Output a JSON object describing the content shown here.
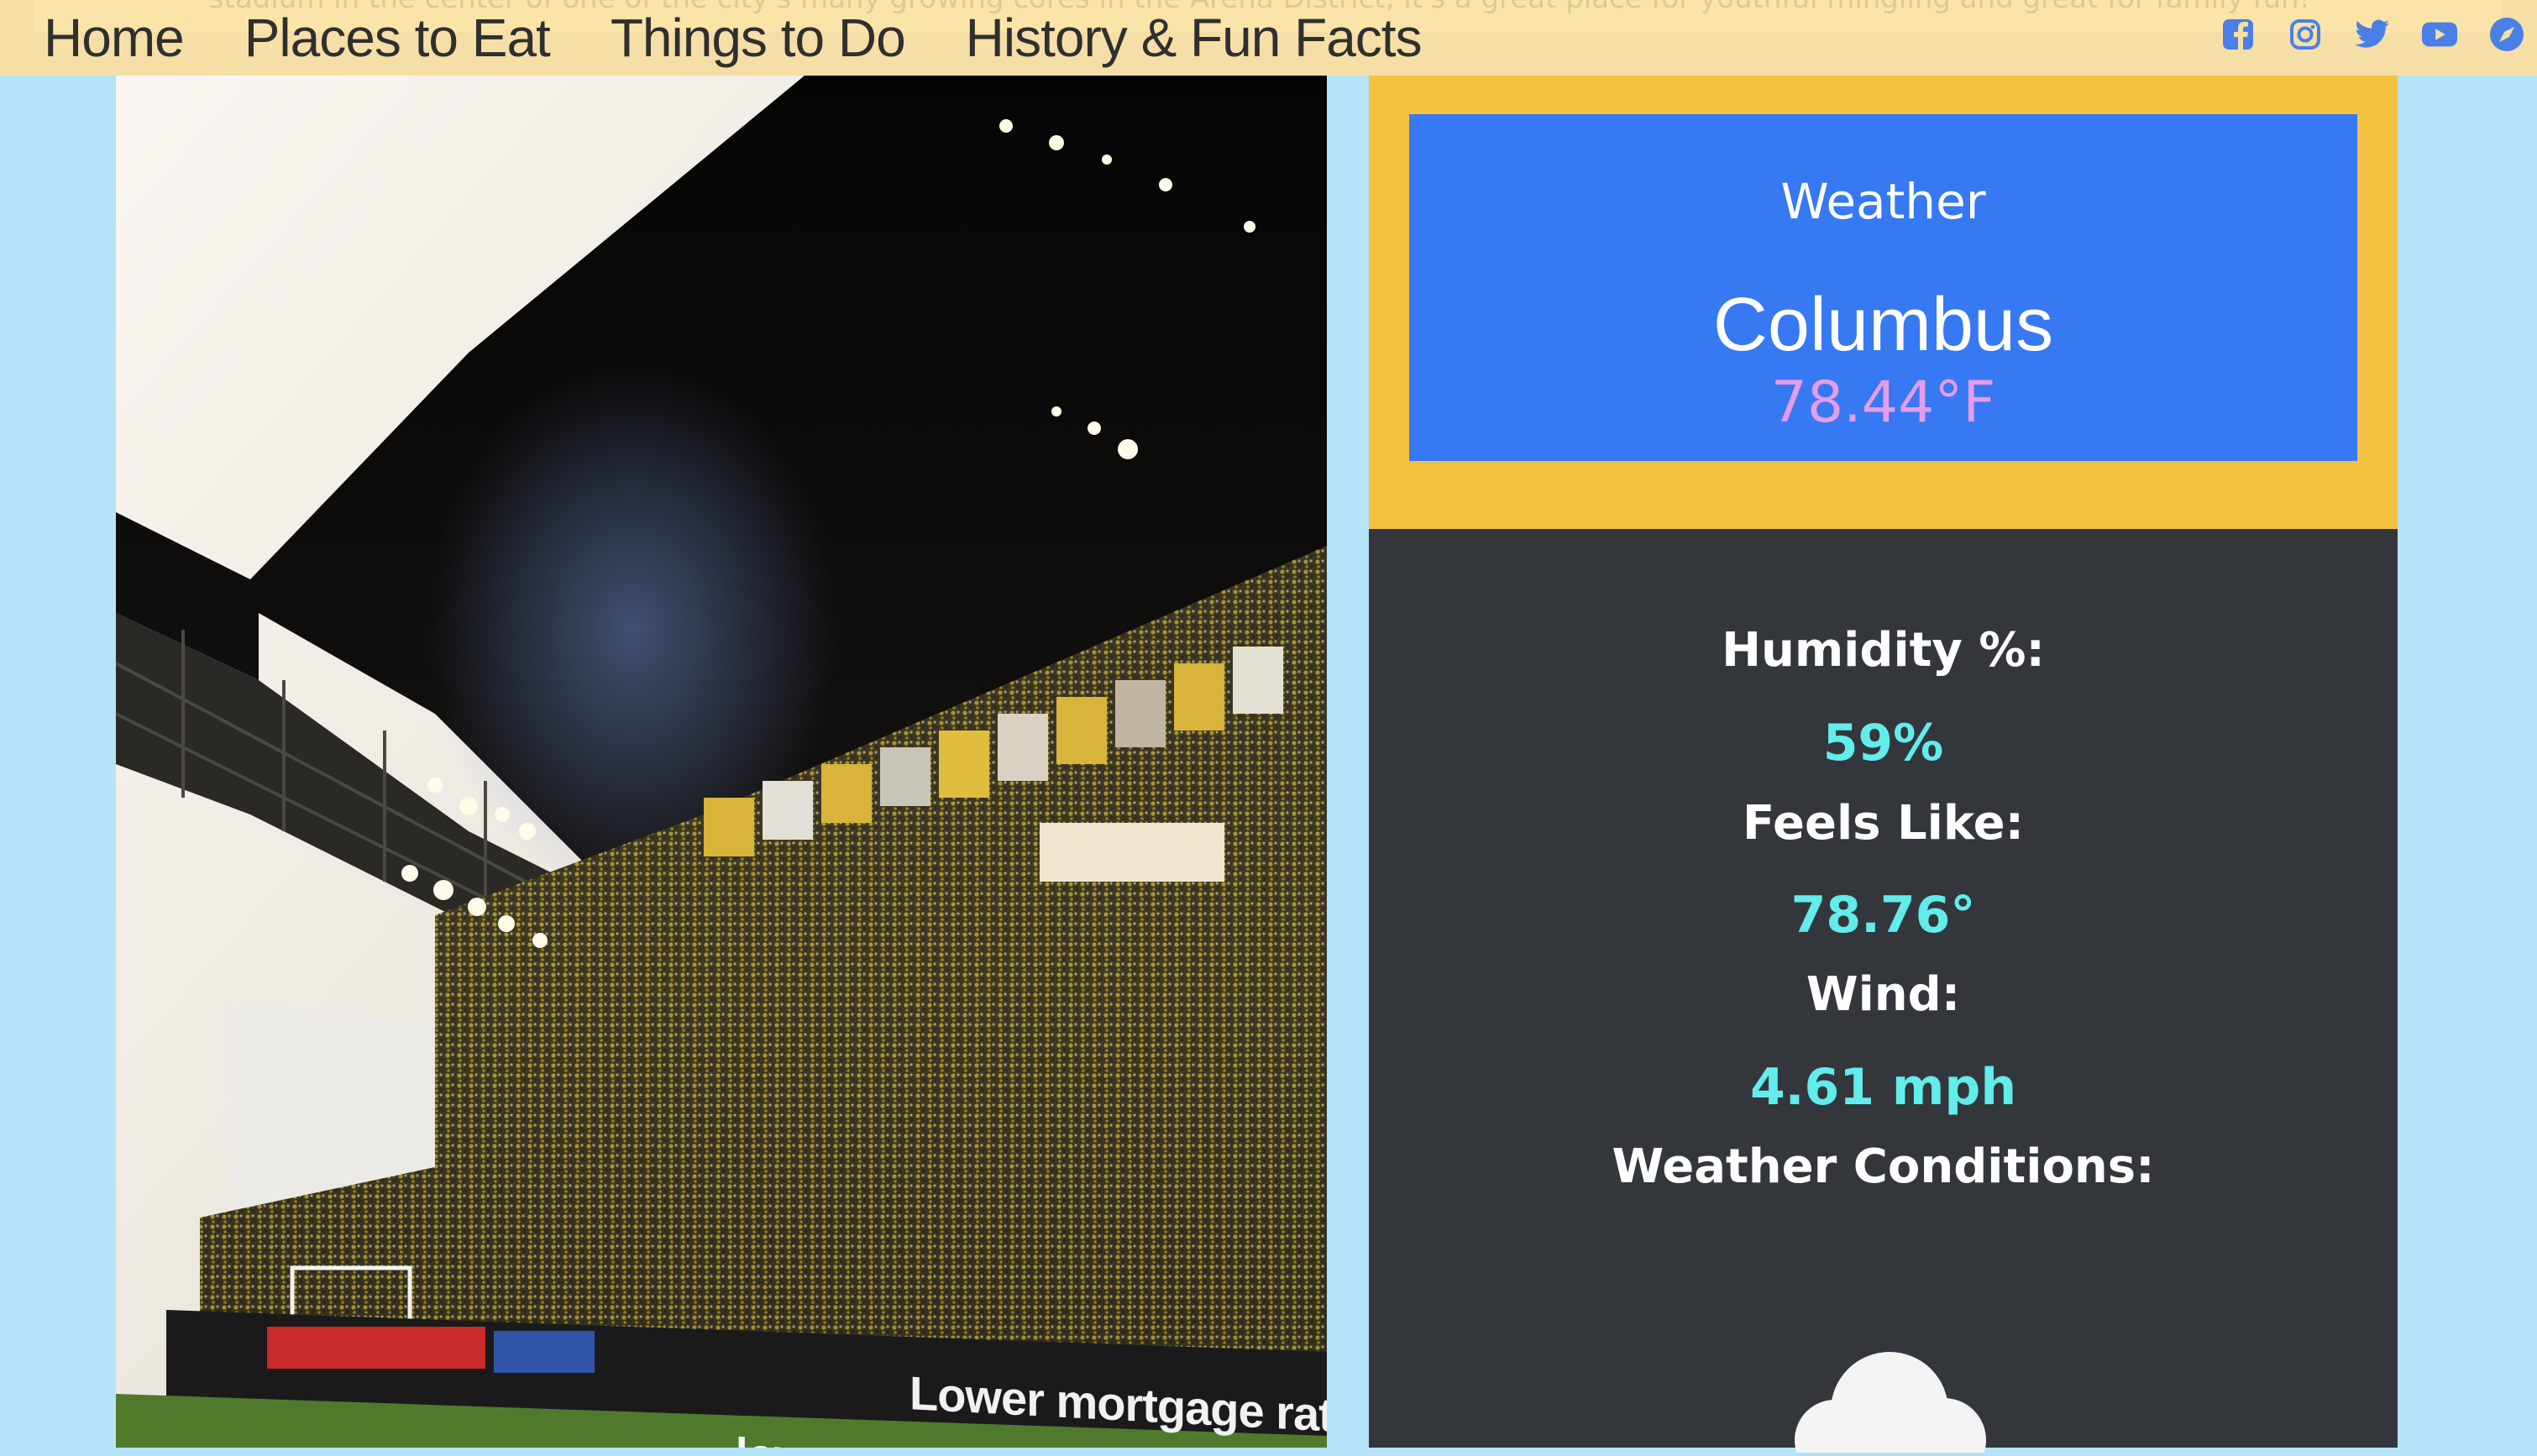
{
  "nav": {
    "links": [
      {
        "label": "Home"
      },
      {
        "label": "Places to Eat"
      },
      {
        "label": "Things to Do"
      },
      {
        "label": "History & Fun Facts"
      }
    ],
    "social": [
      "facebook-icon",
      "instagram-icon",
      "twitter-icon",
      "youtube-icon",
      "compass-icon"
    ]
  },
  "background_text": "stadium in the center of one of the city's many growing cores in the Arena District, it's a great place for youthful mingling and great for family fun!",
  "hero": {
    "image_subject": "soccer stadium stands",
    "banner_text": "Lower mortgage rates. That simple.",
    "logo_text": "lower.com"
  },
  "weather": {
    "heading": "Weather",
    "city": "Columbus",
    "temperature": "78.44°F",
    "humidity_label": "Humidity %:",
    "humidity_value": "59%",
    "feels_like_label": "Feels Like:",
    "feels_like_value": "78.76°",
    "wind_label": "Wind:",
    "wind_value": "4.61 mph",
    "conditions_label": "Weather Conditions:",
    "conditions_icon": "cloud-icon"
  },
  "colors": {
    "page_bg": "#b6e3fa",
    "nav_bg": "#f5dfa6",
    "social_icon": "#4a7fe6",
    "card_frame": "#f4c241",
    "card_inner": "#3778f3",
    "temp_text": "#e59ce9",
    "details_bg": "#33373b",
    "detail_value": "#62ecec"
  }
}
